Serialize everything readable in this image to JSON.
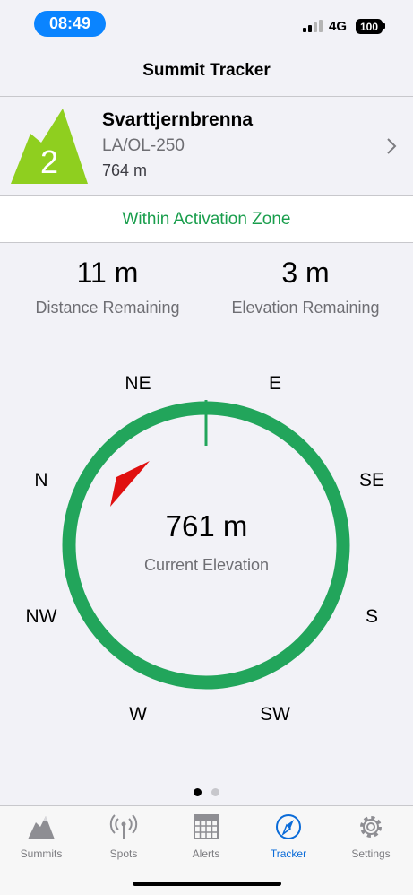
{
  "status_bar": {
    "time": "08:49",
    "network": "4G",
    "battery": "100"
  },
  "nav": {
    "title": "Summit Tracker"
  },
  "summit": {
    "points": "2",
    "name": "Svarttjernbrenna",
    "reference": "LA/OL-250",
    "altitude": "764 m",
    "icon_color": "#8fcf1f"
  },
  "zone_status": "Within Activation Zone",
  "stats": {
    "distance_value": "11 m",
    "distance_label": "Distance Remaining",
    "elevation_value": "3 m",
    "elevation_label": "Elevation Remaining"
  },
  "compass": {
    "directions": {
      "ne": "NE",
      "e": "E",
      "n": "N",
      "se": "SE",
      "nw": "NW",
      "s": "S",
      "w": "W",
      "sw": "SW"
    },
    "ring_color": "#22a55b",
    "arrow_color": "#e01010",
    "current_elevation_value": "761 m",
    "current_elevation_label": "Current Elevation"
  },
  "pagination": {
    "pages": 2,
    "active_page": 1
  },
  "tabs": [
    {
      "label": "Summits",
      "icon": "mountain-icon",
      "active": false
    },
    {
      "label": "Spots",
      "icon": "antenna-icon",
      "active": false
    },
    {
      "label": "Alerts",
      "icon": "calendar-icon",
      "active": false
    },
    {
      "label": "Tracker",
      "icon": "compass-icon",
      "active": true
    },
    {
      "label": "Settings",
      "icon": "gear-icon",
      "active": false
    }
  ]
}
